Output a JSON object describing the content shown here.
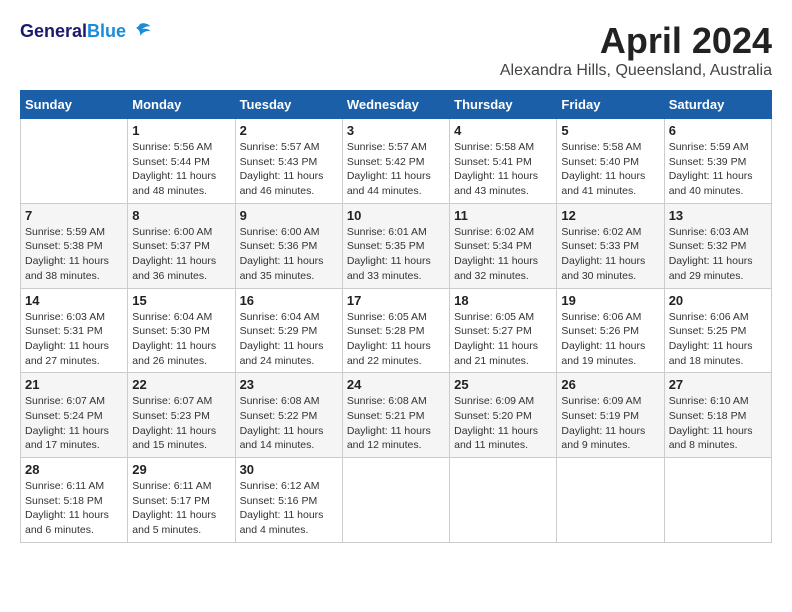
{
  "header": {
    "logo_line1": "General",
    "logo_line2": "Blue",
    "month": "April 2024",
    "location": "Alexandra Hills, Queensland, Australia"
  },
  "weekdays": [
    "Sunday",
    "Monday",
    "Tuesday",
    "Wednesday",
    "Thursday",
    "Friday",
    "Saturday"
  ],
  "weeks": [
    [
      {
        "day": "",
        "info": ""
      },
      {
        "day": "1",
        "info": "Sunrise: 5:56 AM\nSunset: 5:44 PM\nDaylight: 11 hours\nand 48 minutes."
      },
      {
        "day": "2",
        "info": "Sunrise: 5:57 AM\nSunset: 5:43 PM\nDaylight: 11 hours\nand 46 minutes."
      },
      {
        "day": "3",
        "info": "Sunrise: 5:57 AM\nSunset: 5:42 PM\nDaylight: 11 hours\nand 44 minutes."
      },
      {
        "day": "4",
        "info": "Sunrise: 5:58 AM\nSunset: 5:41 PM\nDaylight: 11 hours\nand 43 minutes."
      },
      {
        "day": "5",
        "info": "Sunrise: 5:58 AM\nSunset: 5:40 PM\nDaylight: 11 hours\nand 41 minutes."
      },
      {
        "day": "6",
        "info": "Sunrise: 5:59 AM\nSunset: 5:39 PM\nDaylight: 11 hours\nand 40 minutes."
      }
    ],
    [
      {
        "day": "7",
        "info": "Sunrise: 5:59 AM\nSunset: 5:38 PM\nDaylight: 11 hours\nand 38 minutes."
      },
      {
        "day": "8",
        "info": "Sunrise: 6:00 AM\nSunset: 5:37 PM\nDaylight: 11 hours\nand 36 minutes."
      },
      {
        "day": "9",
        "info": "Sunrise: 6:00 AM\nSunset: 5:36 PM\nDaylight: 11 hours\nand 35 minutes."
      },
      {
        "day": "10",
        "info": "Sunrise: 6:01 AM\nSunset: 5:35 PM\nDaylight: 11 hours\nand 33 minutes."
      },
      {
        "day": "11",
        "info": "Sunrise: 6:02 AM\nSunset: 5:34 PM\nDaylight: 11 hours\nand 32 minutes."
      },
      {
        "day": "12",
        "info": "Sunrise: 6:02 AM\nSunset: 5:33 PM\nDaylight: 11 hours\nand 30 minutes."
      },
      {
        "day": "13",
        "info": "Sunrise: 6:03 AM\nSunset: 5:32 PM\nDaylight: 11 hours\nand 29 minutes."
      }
    ],
    [
      {
        "day": "14",
        "info": "Sunrise: 6:03 AM\nSunset: 5:31 PM\nDaylight: 11 hours\nand 27 minutes."
      },
      {
        "day": "15",
        "info": "Sunrise: 6:04 AM\nSunset: 5:30 PM\nDaylight: 11 hours\nand 26 minutes."
      },
      {
        "day": "16",
        "info": "Sunrise: 6:04 AM\nSunset: 5:29 PM\nDaylight: 11 hours\nand 24 minutes."
      },
      {
        "day": "17",
        "info": "Sunrise: 6:05 AM\nSunset: 5:28 PM\nDaylight: 11 hours\nand 22 minutes."
      },
      {
        "day": "18",
        "info": "Sunrise: 6:05 AM\nSunset: 5:27 PM\nDaylight: 11 hours\nand 21 minutes."
      },
      {
        "day": "19",
        "info": "Sunrise: 6:06 AM\nSunset: 5:26 PM\nDaylight: 11 hours\nand 19 minutes."
      },
      {
        "day": "20",
        "info": "Sunrise: 6:06 AM\nSunset: 5:25 PM\nDaylight: 11 hours\nand 18 minutes."
      }
    ],
    [
      {
        "day": "21",
        "info": "Sunrise: 6:07 AM\nSunset: 5:24 PM\nDaylight: 11 hours\nand 17 minutes."
      },
      {
        "day": "22",
        "info": "Sunrise: 6:07 AM\nSunset: 5:23 PM\nDaylight: 11 hours\nand 15 minutes."
      },
      {
        "day": "23",
        "info": "Sunrise: 6:08 AM\nSunset: 5:22 PM\nDaylight: 11 hours\nand 14 minutes."
      },
      {
        "day": "24",
        "info": "Sunrise: 6:08 AM\nSunset: 5:21 PM\nDaylight: 11 hours\nand 12 minutes."
      },
      {
        "day": "25",
        "info": "Sunrise: 6:09 AM\nSunset: 5:20 PM\nDaylight: 11 hours\nand 11 minutes."
      },
      {
        "day": "26",
        "info": "Sunrise: 6:09 AM\nSunset: 5:19 PM\nDaylight: 11 hours\nand 9 minutes."
      },
      {
        "day": "27",
        "info": "Sunrise: 6:10 AM\nSunset: 5:18 PM\nDaylight: 11 hours\nand 8 minutes."
      }
    ],
    [
      {
        "day": "28",
        "info": "Sunrise: 6:11 AM\nSunset: 5:18 PM\nDaylight: 11 hours\nand 6 minutes."
      },
      {
        "day": "29",
        "info": "Sunrise: 6:11 AM\nSunset: 5:17 PM\nDaylight: 11 hours\nand 5 minutes."
      },
      {
        "day": "30",
        "info": "Sunrise: 6:12 AM\nSunset: 5:16 PM\nDaylight: 11 hours\nand 4 minutes."
      },
      {
        "day": "",
        "info": ""
      },
      {
        "day": "",
        "info": ""
      },
      {
        "day": "",
        "info": ""
      },
      {
        "day": "",
        "info": ""
      }
    ]
  ]
}
